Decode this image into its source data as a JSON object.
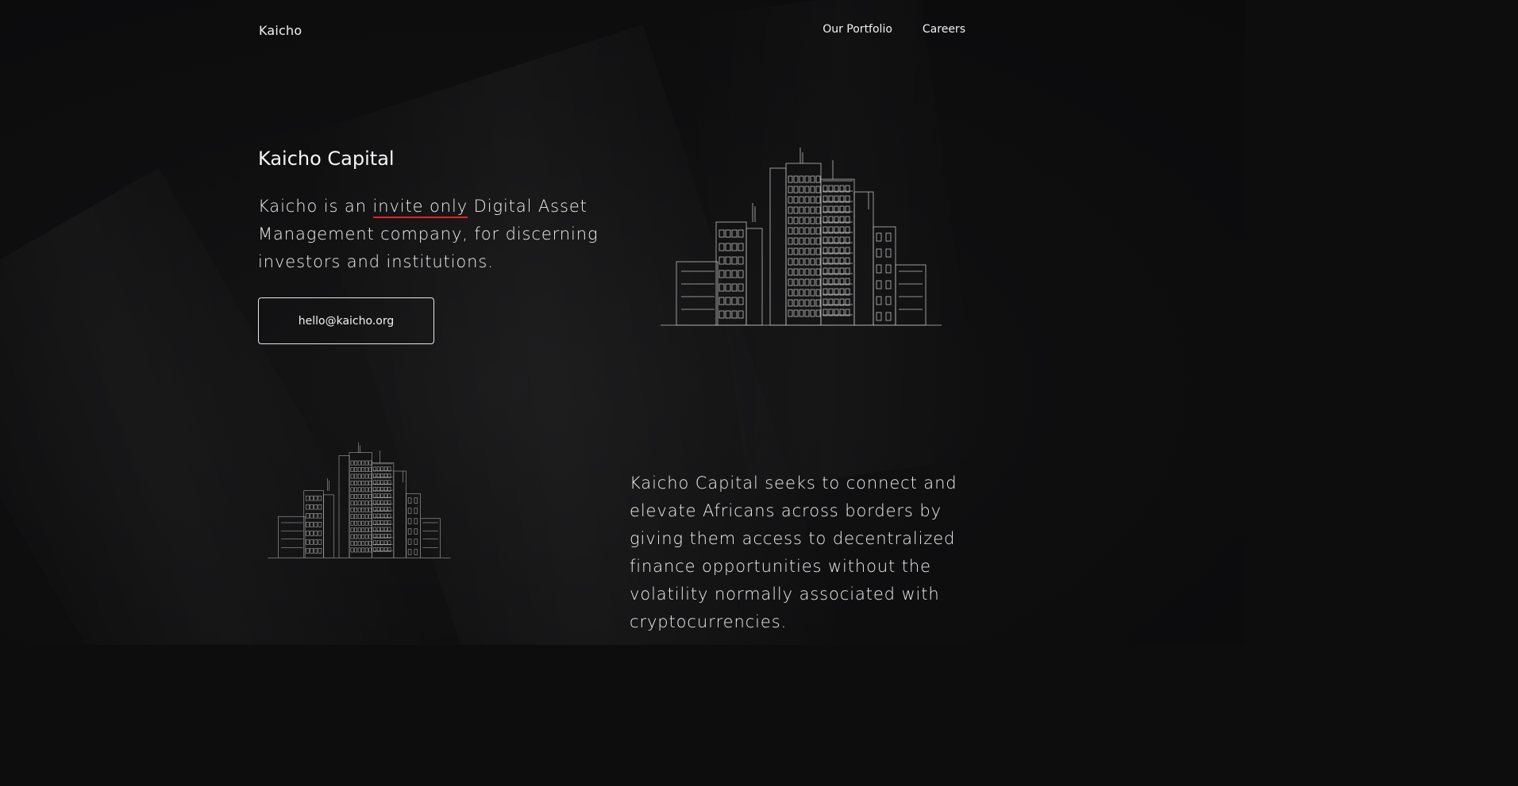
{
  "brand": {
    "logo": "Kaicho"
  },
  "nav": {
    "portfolio": "Our Portfolio",
    "careers": "Careers"
  },
  "hero": {
    "title": "Kaicho Capital",
    "desc_before": "Kaicho is an ",
    "desc_highlight": "invite only",
    "desc_after": " Digital Asset Management company, for discerning investors and institutions.",
    "cta": "hello@kaicho.org"
  },
  "mission": {
    "text": "Kaicho Capital seeks to connect and elevate Africans across borders by giving them access to decentralized finance opportunities without the volatility normally associated with cryptocurrencies."
  },
  "colors": {
    "background": "#0d0d0e",
    "text": "#f0f0f0",
    "accent_underline": "#e0242b",
    "line_art": "#bfbfbf"
  },
  "images": {
    "hero_illustration": "building-line-art",
    "mission_illustration": "building-line-art"
  }
}
